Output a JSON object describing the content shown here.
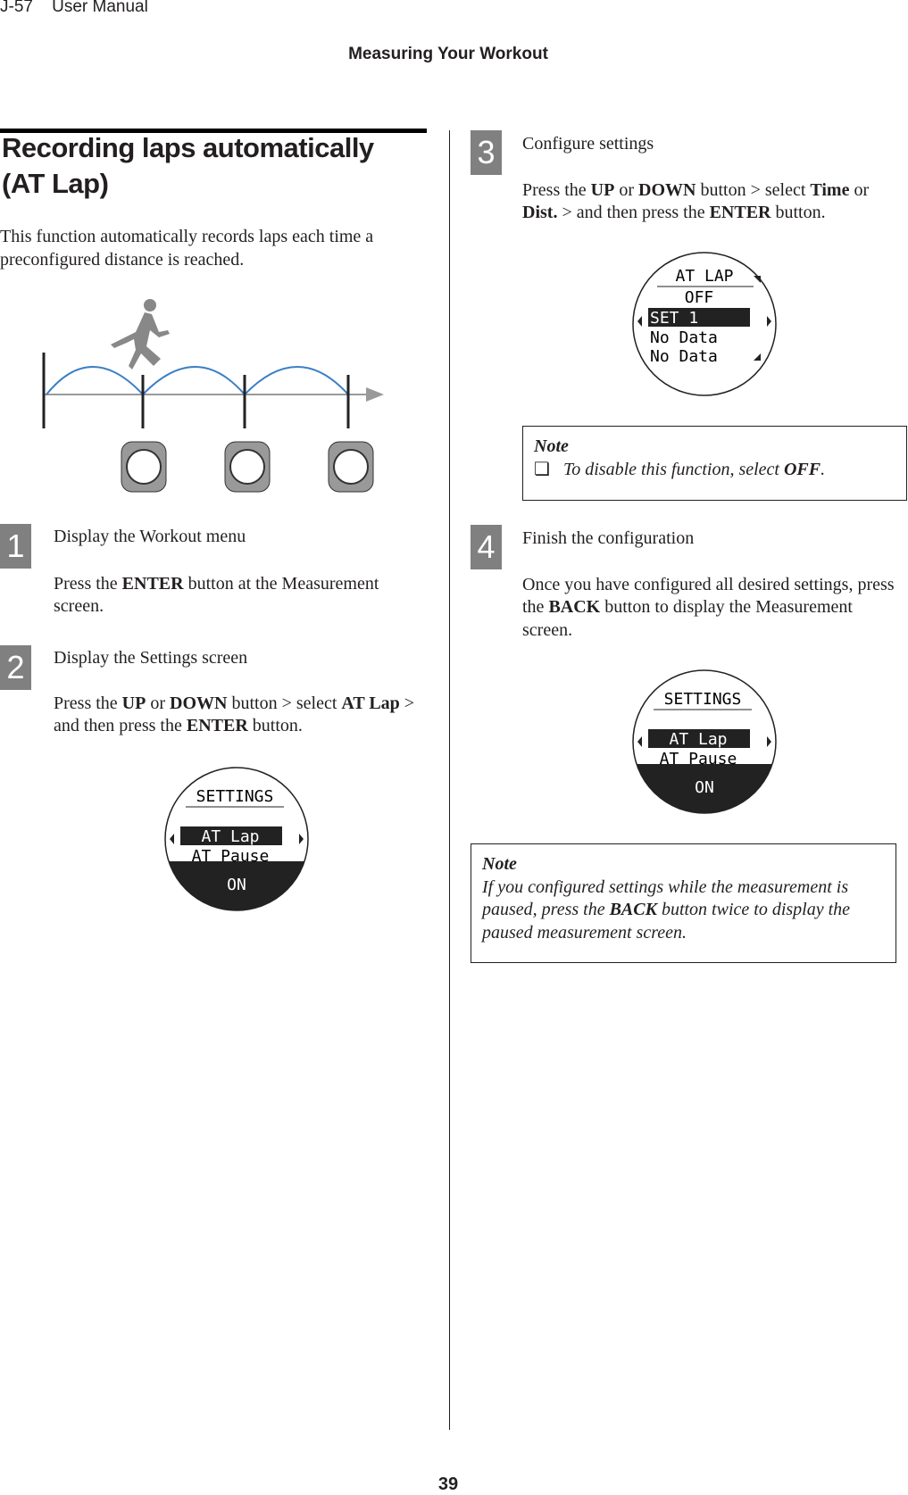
{
  "header": {
    "page_code": "J-57",
    "manual": "User Manual",
    "section": "Measuring Your Workout"
  },
  "title": {
    "line1": "Recording laps automatically",
    "line2": "(AT Lap)"
  },
  "intro": "This function automatically records laps each time a preconfigured distance is reached.",
  "steps": [
    {
      "number": "1",
      "heading": "Display the Workout menu",
      "body": [
        "Press the ",
        "ENTER",
        " button at the Measurement screen."
      ]
    },
    {
      "number": "2",
      "heading": "Display the Settings screen",
      "body": [
        "Press the ",
        "UP",
        " or ",
        "DOWN",
        " button > select ",
        "AT Lap",
        " > and then press the ",
        "ENTER",
        " button."
      ]
    },
    {
      "number": "3",
      "heading": "Configure settings",
      "body": [
        "Press the ",
        "UP",
        " or ",
        "DOWN",
        " button > select ",
        "Time",
        " or ",
        "Dist.",
        " > and then press the ",
        "ENTER",
        " button."
      ]
    },
    {
      "number": "4",
      "heading": "Finish the configuration",
      "body": [
        "Once you have configured all desired settings, press the ",
        "BACK",
        " button to display the Measurement screen."
      ]
    }
  ],
  "screens": {
    "settings": {
      "title": "SETTINGS",
      "selected": "AT Lap",
      "item2": "AT Pause",
      "value": "ON"
    },
    "atlap": {
      "title": "AT LAP",
      "value": "OFF",
      "selected": "SET 1",
      "row2": "No Data",
      "row3": "No Data"
    }
  },
  "note1": {
    "label": "Note",
    "bullet": "❏",
    "text": "To disable this function, select ",
    "bold": "OFF",
    "end": "."
  },
  "note2": {
    "label": "Note",
    "text1": "If you configured settings while the measurement is paused, press the ",
    "bold": "BACK",
    "text2": " button twice to display the paused measurement screen."
  },
  "page_number": "39",
  "colors": {
    "badge": "#808080",
    "arc": "#3a7fc4"
  }
}
